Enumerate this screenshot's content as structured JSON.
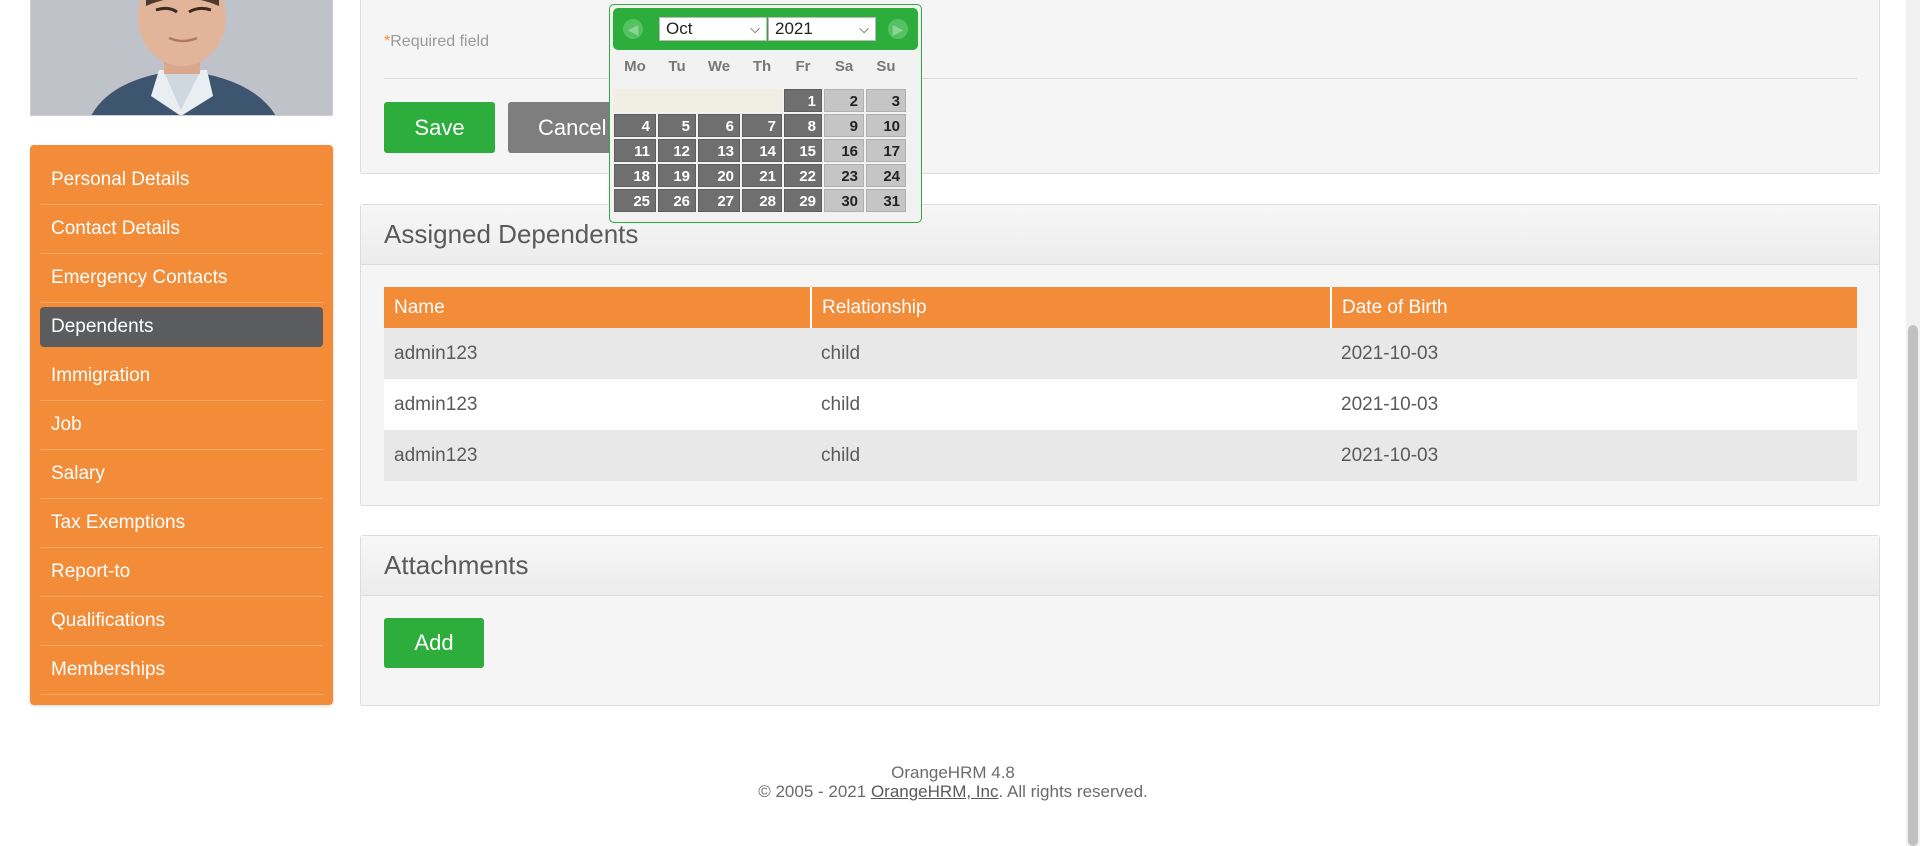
{
  "form": {
    "required_star": "*",
    "required_text": "Required field",
    "save_label": "Save",
    "cancel_label": "Cancel"
  },
  "sidebar": {
    "items": [
      {
        "label": "Personal Details"
      },
      {
        "label": "Contact Details"
      },
      {
        "label": "Emergency Contacts"
      },
      {
        "label": "Dependents",
        "active": true
      },
      {
        "label": "Immigration"
      },
      {
        "label": "Job"
      },
      {
        "label": "Salary"
      },
      {
        "label": "Tax Exemptions"
      },
      {
        "label": "Report-to"
      },
      {
        "label": "Qualifications"
      },
      {
        "label": "Memberships"
      }
    ]
  },
  "dependents": {
    "title": "Assigned Dependents",
    "columns": [
      "Name",
      "Relationship",
      "Date of Birth"
    ],
    "rows": [
      [
        "admin123",
        "child",
        "2021-10-03"
      ],
      [
        "admin123",
        "child",
        "2021-10-03"
      ],
      [
        "admin123",
        "child",
        "2021-10-03"
      ]
    ]
  },
  "attachments": {
    "title": "Attachments",
    "add_label": "Add"
  },
  "datepicker": {
    "month": "Oct",
    "year": "2021",
    "weekdays": [
      "Mo",
      "Tu",
      "We",
      "Th",
      "Fr",
      "Sa",
      "Su"
    ],
    "leading_blanks": 4,
    "days_in_month": 31
  },
  "footer": {
    "version": "OrangeHRM 4.8",
    "copyright_prefix": "© 2005 - 2021 ",
    "company_link": "OrangeHRM, Inc",
    "copyright_suffix": ". All rights reserved."
  },
  "colors": {
    "accent_orange": "#f28c38",
    "accent_green": "#2cad3c",
    "active_nav": "#5b5c5d"
  }
}
